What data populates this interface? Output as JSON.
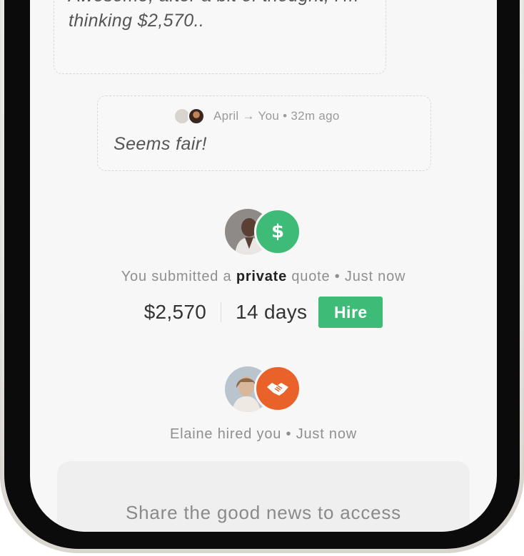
{
  "messages": [
    {
      "meta": "",
      "text_line1": "Awesome, after a bit of thought, I'm",
      "text_line2": "thinking $2,570.."
    },
    {
      "meta": "April → You • 32m ago",
      "text_line1": "Seems fair!"
    }
  ],
  "quote_activity": {
    "icon": "dollar-icon",
    "caption_prefix": "You submitted a ",
    "caption_bold": "private",
    "caption_suffix": " quote • Just now",
    "amount": "$2,570",
    "duration": "14 days",
    "hire_label": "Hire",
    "icon_color": "#3dbb77"
  },
  "hire_activity": {
    "icon": "handshake-icon",
    "caption": "Elaine hired you • Just now",
    "icon_color": "#e8622a"
  },
  "share": {
    "text": "Share the good news to access"
  }
}
